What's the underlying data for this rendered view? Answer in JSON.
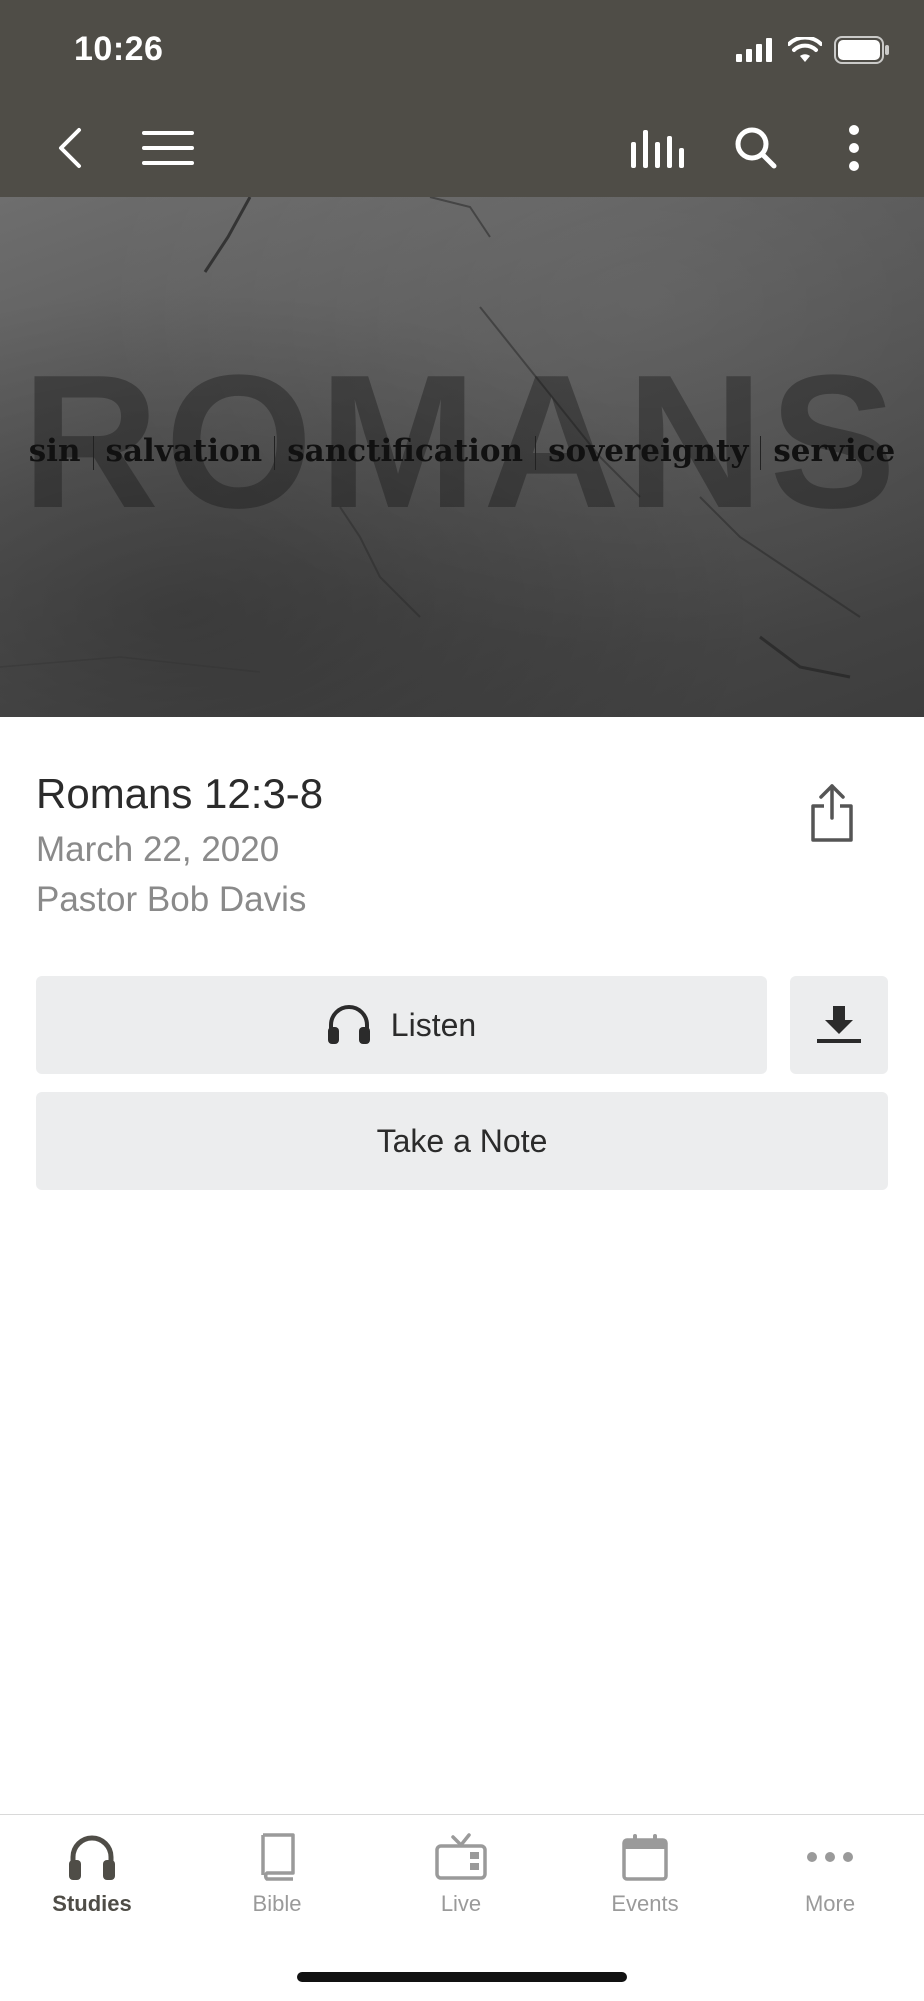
{
  "status_bar": {
    "time": "10:26",
    "icons": [
      "signal-icon",
      "wifi-icon",
      "battery-icon"
    ]
  },
  "nav": {
    "icons": [
      "back-icon",
      "menu-icon",
      "audio-bars-icon",
      "search-icon",
      "more-vertical-icon"
    ]
  },
  "hero": {
    "big_text": "ROMANS",
    "subtitle_words": [
      "sin",
      "salvation",
      "sanctification",
      "sovereignty",
      "service"
    ]
  },
  "sermon": {
    "title": "Romans 12:3-8",
    "date": "March 22, 2020",
    "speaker": "Pastor Bob Davis"
  },
  "actions": {
    "listen_label": "Listen",
    "note_label": "Take a Note"
  },
  "tabs": [
    {
      "label": "Studies",
      "icon": "headphones-icon",
      "active": true
    },
    {
      "label": "Bible",
      "icon": "book-icon",
      "active": false
    },
    {
      "label": "Live",
      "icon": "tv-icon",
      "active": false
    },
    {
      "label": "Events",
      "icon": "calendar-icon",
      "active": false
    },
    {
      "label": "More",
      "icon": "more-horizontal-icon",
      "active": false
    }
  ],
  "colors": {
    "header": "#4f4d47",
    "button_bg": "#ecedee",
    "muted_text": "#8a8a8a"
  }
}
